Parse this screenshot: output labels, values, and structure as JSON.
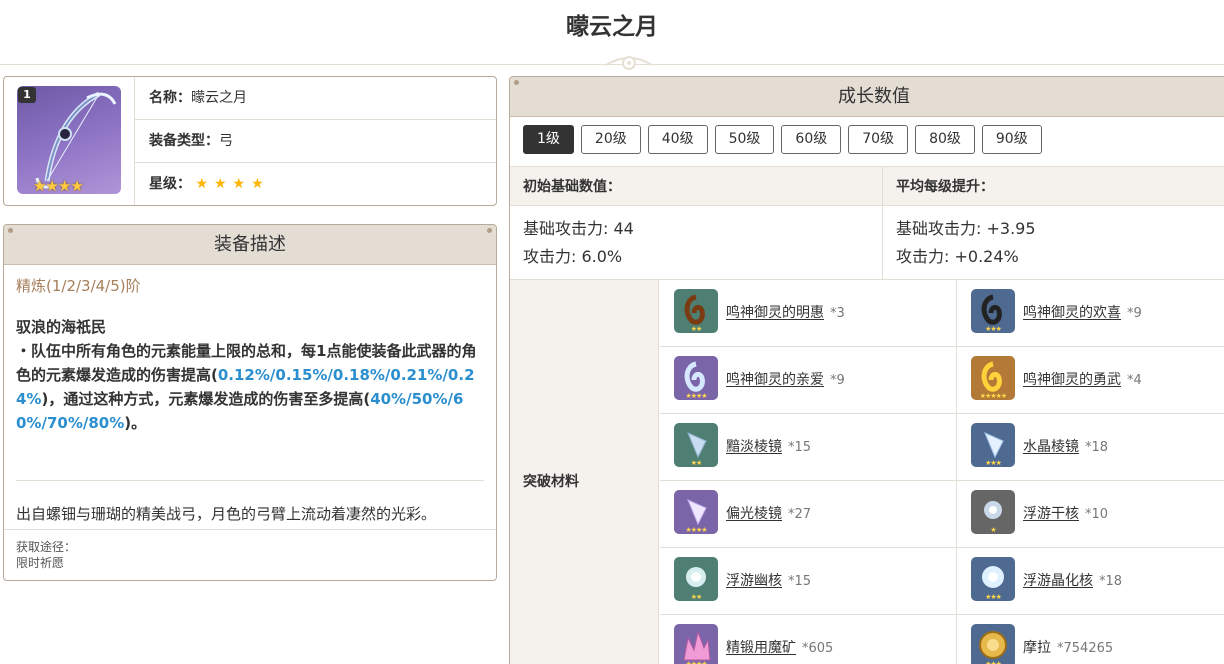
{
  "page": {
    "title": "曚云之月"
  },
  "info": {
    "refine_badge": "1",
    "img_stars": "★★★★",
    "name_key": "名称：",
    "name_val": "曚云之月",
    "type_key": "装备类型：",
    "type_val": "弓",
    "rarity_key": "星级：",
    "rarity_stars": "★★★★"
  },
  "desc": {
    "header": "装备描述",
    "refine_title": "精炼(1/2/3/4/5)阶",
    "passive_name": "驭浪的海祇民",
    "passive_part1": "・队伍中所有角色的元素能量上限的总和，每1点能使装备此武器的角色的元素爆发造成的伤害提高(",
    "passive_val1": "0.12%/0.15%/0.18%/0.21%/0.24%",
    "passive_part2": ")，通过这种方式，元素爆发造成的伤害至多提高(",
    "passive_val2": "40%/50%/60%/70%/80%",
    "passive_part3": ")。",
    "flavor": "出自螺钿与珊瑚的精美战弓，月色的弓臂上流动着凄然的光彩。",
    "source_label": "获取途径：",
    "source_value": "限时祈愿"
  },
  "growth": {
    "header": "成长数值",
    "levels": [
      "1级",
      "20级",
      "40级",
      "50级",
      "60级",
      "70级",
      "80级",
      "90级"
    ],
    "active_level": "1级",
    "base_head": "初始基础数值：",
    "avg_head": "平均每级提升：",
    "base_atk": "基础攻击力: 44",
    "base_sub": "攻击力: 6.0%",
    "avg_atk": "基础攻击力: +3.95",
    "avg_sub": "攻击力: +0.24%",
    "materials_label": "突破材料",
    "materials": [
      {
        "name": "鸣神御灵的明惠",
        "count": "*3",
        "icon": "mask-shell-icon",
        "rarity_color": "#4f7f72",
        "stars": "★★"
      },
      {
        "name": "鸣神御灵的欢喜",
        "count": "*9",
        "icon": "mask-swirl-icon",
        "rarity_color": "#4f6a90",
        "stars": "★★★"
      },
      {
        "name": "鸣神御灵的亲爱",
        "count": "*9",
        "icon": "mask-blue-icon",
        "rarity_color": "#7a65a8",
        "stars": "★★★★"
      },
      {
        "name": "鸣神御灵的勇武",
        "count": "*4",
        "icon": "mask-gold-icon",
        "rarity_color": "#b27a36",
        "stars": "★★★★★"
      },
      {
        "name": "黯淡棱镜",
        "count": "*15",
        "icon": "prism-dim-icon",
        "rarity_color": "#4f7f72",
        "stars": "★★"
      },
      {
        "name": "水晶棱镜",
        "count": "*18",
        "icon": "prism-crystal-icon",
        "rarity_color": "#4f6a90",
        "stars": "★★★"
      },
      {
        "name": "偏光棱镜",
        "count": "*27",
        "icon": "prism-polar-icon",
        "rarity_color": "#7a65a8",
        "stars": "★★★★"
      },
      {
        "name": "浮游干核",
        "count": "*10",
        "icon": "core-dry-icon",
        "rarity_color": "#666666",
        "stars": "★"
      },
      {
        "name": "浮游幽核",
        "count": "*15",
        "icon": "core-ghost-icon",
        "rarity_color": "#4f7f72",
        "stars": "★★"
      },
      {
        "name": "浮游晶化核",
        "count": "*18",
        "icon": "core-crystal-icon",
        "rarity_color": "#4f6a90",
        "stars": "★★★"
      },
      {
        "name": "精锻用魔矿",
        "count": "*605",
        "icon": "ore-icon",
        "rarity_color": "#7a65a8",
        "stars": "★★★★"
      },
      {
        "name": "摩拉",
        "count": "*754265",
        "icon": "mora-coin-icon",
        "rarity_color": "#4f6a90",
        "stars": "★★★"
      }
    ]
  }
}
